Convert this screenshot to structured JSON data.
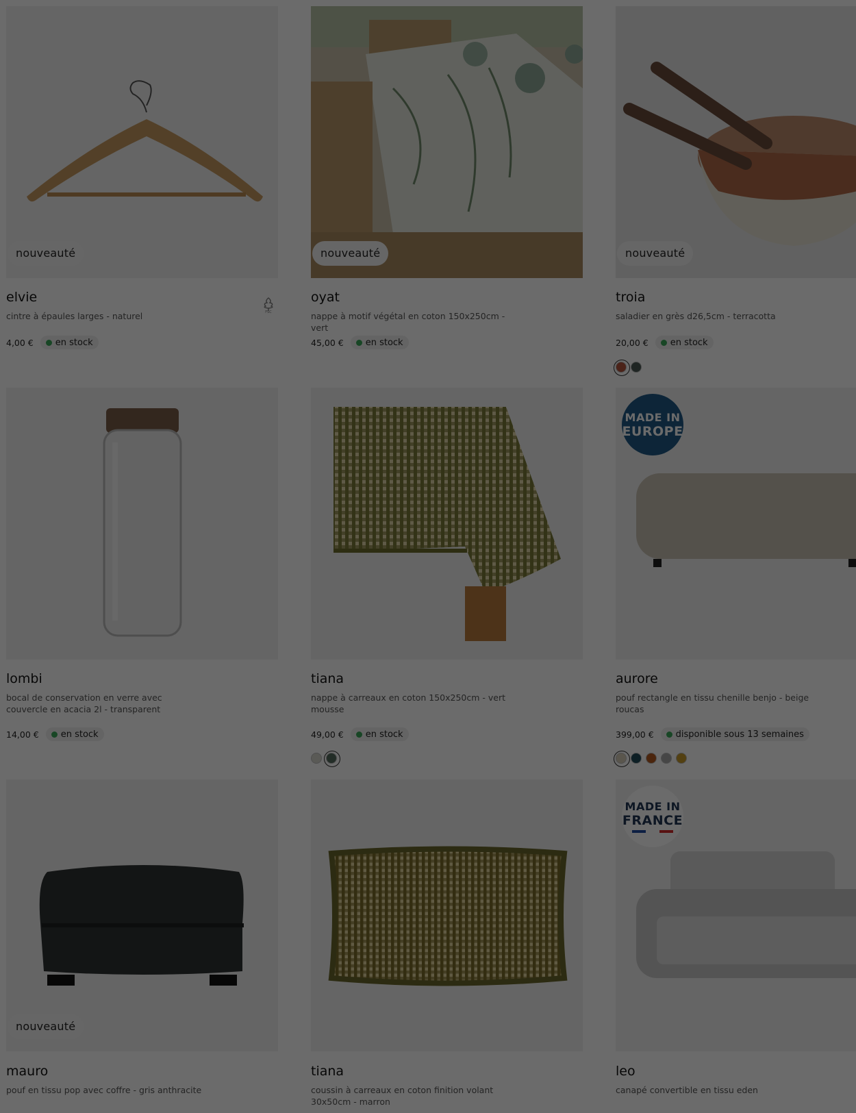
{
  "products": [
    {
      "name": "elvie",
      "description": "cintre à épaules larges - naturel",
      "price": "4,00 €",
      "stock": "en stock",
      "badge": "nouveauté"
    },
    {
      "name": "oyat",
      "description": "nappe à motif végétal en coton 150x250cm - vert",
      "price": "45,00 €",
      "stock": "en stock",
      "badge": "nouveauté"
    },
    {
      "name": "troia",
      "description": "saladier en grès d26,5cm - terracotta",
      "price": "20,00 €",
      "stock": "en stock",
      "badge": "nouveauté",
      "swatches": [
        "#b4533c",
        "#4b5a55"
      ]
    },
    {
      "name": "lombi",
      "description": "bocal de conservation en verre avec couvercle en acacia 2l - transparent",
      "price": "14,00 €",
      "stock": "en stock"
    },
    {
      "name": "tiana",
      "description": "nappe à carreaux en coton 150x250cm - vert mousse",
      "price": "49,00 €",
      "stock": "en stock",
      "swatches": [
        "#d7d6cc",
        "#556b5e"
      ]
    },
    {
      "name": "aurore",
      "description": "pouf rectangle en tissu chenille benjo - beige roucas",
      "price": "399,00 €",
      "stock": "disponible sous 13 semaines",
      "seal": {
        "line1": "MADE IN",
        "line2": "EUROPE"
      },
      "swatches": [
        "#d7cdb8",
        "#1f4a5a",
        "#b45a1f",
        "#a8a8a8",
        "#c79a2a"
      ]
    },
    {
      "name": "mauro",
      "description": "pouf en tissu pop avec coffre - gris anthracite",
      "badge": "nouveauté"
    },
    {
      "name": "tiana",
      "description": "coussin à carreaux en coton finition volant 30x50cm - marron"
    },
    {
      "name": "leo",
      "description": "canapé convertible en tissu eden",
      "seal": {
        "line1": "MADE IN",
        "line2": "FRANCE"
      }
    }
  ],
  "icons": {
    "fsc": "fsc-tree-icon"
  }
}
